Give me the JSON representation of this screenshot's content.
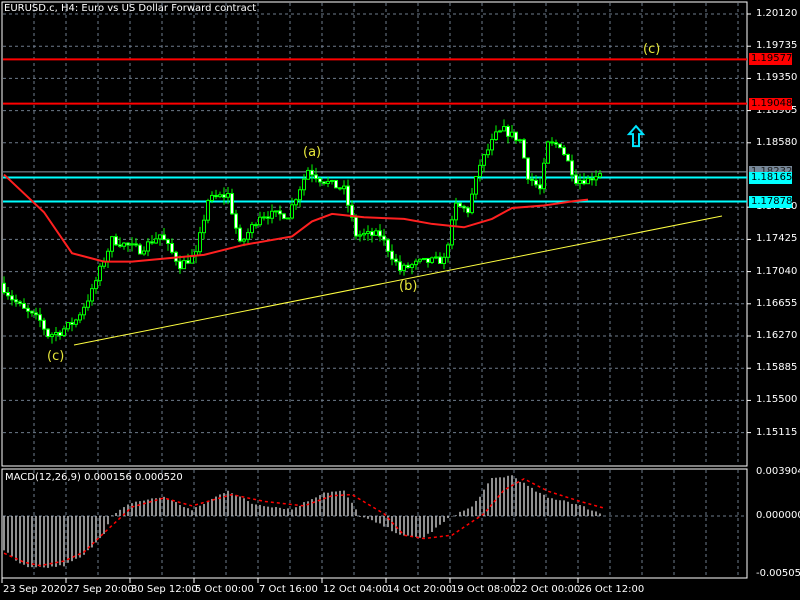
{
  "header": {
    "title": "EURUSD.c, H4:  Euro vs US Dollar Forward contract"
  },
  "colors": {
    "bull": "#00ff00",
    "bear_body": "#ffffff",
    "ma": "#ff2020",
    "trend": "#ffff40",
    "hline_red": "#ff0000",
    "hline_cyan": "#00ffff",
    "grid": "#6e7b8b",
    "macd_hist": "#c0c0c0",
    "macd_signal": "#ff0000"
  },
  "price_axis": {
    "ticks": [
      "1.20120",
      "1.19735",
      "1.19350",
      "1.18965",
      "1.18580",
      "1.17810",
      "1.17425",
      "1.17040",
      "1.16655",
      "1.16270",
      "1.15885",
      "1.15500",
      "1.15115"
    ],
    "max": 1.2012,
    "step": 0.00385
  },
  "price_tags": [
    {
      "value": "1.19577",
      "kind": "red"
    },
    {
      "value": "1.19048",
      "kind": "red"
    },
    {
      "value": "1.18232",
      "kind": "grey"
    },
    {
      "value": "1.18165",
      "kind": "cyan"
    },
    {
      "value": "1.17878",
      "kind": "cyan"
    }
  ],
  "price_anchors": [
    [
      0,
      1.169
    ],
    [
      3,
      1.1672
    ],
    [
      6,
      1.1658
    ],
    [
      10,
      1.1645
    ],
    [
      12,
      1.1628
    ],
    [
      15,
      1.1632
    ],
    [
      19,
      1.1646
    ],
    [
      23,
      1.168
    ],
    [
      25,
      1.1706
    ],
    [
      28,
      1.1742
    ],
    [
      32,
      1.1735
    ],
    [
      35,
      1.173
    ],
    [
      40,
      1.1748
    ],
    [
      45,
      1.1712
    ],
    [
      49,
      1.1724
    ],
    [
      52,
      1.179
    ],
    [
      57,
      1.1796
    ],
    [
      60,
      1.1736
    ],
    [
      65,
      1.1772
    ],
    [
      72,
      1.1772
    ],
    [
      77,
      1.1826
    ],
    [
      80,
      1.1815
    ],
    [
      83,
      1.1808
    ],
    [
      86,
      1.1802
    ],
    [
      89,
      1.1748
    ],
    [
      95,
      1.1748
    ],
    [
      100,
      1.1706
    ],
    [
      105,
      1.1715
    ],
    [
      111,
      1.1718
    ],
    [
      114,
      1.1783
    ],
    [
      117,
      1.1777
    ],
    [
      120,
      1.1832
    ],
    [
      124,
      1.1867
    ],
    [
      126,
      1.1873
    ],
    [
      130,
      1.1861
    ],
    [
      132,
      1.1819
    ],
    [
      135,
      1.1802
    ],
    [
      137,
      1.1856
    ],
    [
      140,
      1.1856
    ],
    [
      144,
      1.1814
    ],
    [
      147,
      1.1814
    ],
    [
      150,
      1.1823
    ]
  ],
  "ma_anchors": [
    [
      0,
      1.182
    ],
    [
      10,
      1.1775
    ],
    [
      17,
      1.1726
    ],
    [
      25,
      1.1716
    ],
    [
      32,
      1.1716
    ],
    [
      50,
      1.1724
    ],
    [
      60,
      1.1736
    ],
    [
      72,
      1.1746
    ],
    [
      77,
      1.1764
    ],
    [
      82,
      1.1773
    ],
    [
      90,
      1.1769
    ],
    [
      100,
      1.1767
    ],
    [
      107,
      1.1761
    ],
    [
      115,
      1.1757
    ],
    [
      122,
      1.1767
    ],
    [
      127,
      1.178
    ],
    [
      135,
      1.1783
    ],
    [
      142,
      1.1788
    ],
    [
      146,
      1.179
    ]
  ],
  "trendline": {
    "from": [
      17.5,
      1.16162
    ],
    "to": [
      179.5,
      1.17705
    ]
  },
  "wave_labels": [
    {
      "text": "(c)",
      "bar": 13,
      "price": 1.1601
    },
    {
      "text": "(a)",
      "bar": 77,
      "price": 1.1845
    },
    {
      "text": "(b)",
      "bar": 101,
      "price": 1.1684
    },
    {
      "text": "(c)",
      "bar": 162,
      "price": 1.1968
    }
  ],
  "arrow": {
    "icon": "up-arrow-icon",
    "bar": 158,
    "price": 1.1866
  },
  "macd": {
    "title": "MACD(12,26,9) 0.000156 0.000520",
    "ticks": [
      "0.003904",
      "0.000000",
      "-0.005058"
    ],
    "max": 0.003904,
    "min": -0.005058,
    "hist_anchors": [
      [
        0,
        -0.003
      ],
      [
        3,
        -0.004
      ],
      [
        6,
        -0.0046
      ],
      [
        10,
        -0.0046
      ],
      [
        15,
        -0.0044
      ],
      [
        20,
        -0.0035
      ],
      [
        25,
        -0.0015
      ],
      [
        27,
        0
      ],
      [
        32,
        0.0012
      ],
      [
        40,
        0.0017
      ],
      [
        47,
        0.0005
      ],
      [
        56,
        0.0023
      ],
      [
        62,
        0.0011
      ],
      [
        72,
        0.0006
      ],
      [
        80,
        0.0021
      ],
      [
        85,
        0.0022
      ],
      [
        89,
        0
      ],
      [
        95,
        -0.0009
      ],
      [
        100,
        -0.0018
      ],
      [
        105,
        -0.0019
      ],
      [
        112,
        0
      ],
      [
        117,
        0.0008
      ],
      [
        122,
        0.0033
      ],
      [
        127,
        0.0036
      ],
      [
        132,
        0.0024
      ],
      [
        136,
        0.0016
      ],
      [
        140,
        0.0014
      ],
      [
        145,
        0.0008
      ],
      [
        150,
        0.0001
      ]
    ],
    "signal_anchors": [
      [
        0,
        -0.0033
      ],
      [
        5,
        -0.0041
      ],
      [
        9,
        -0.0044
      ],
      [
        15,
        -0.004
      ],
      [
        20,
        -0.0032
      ],
      [
        25,
        -0.0015
      ],
      [
        32,
        0.0008
      ],
      [
        40,
        0.0016
      ],
      [
        47,
        0.0009
      ],
      [
        57,
        0.0019
      ],
      [
        65,
        0.0013
      ],
      [
        75,
        0.0009
      ],
      [
        82,
        0.0018
      ],
      [
        87,
        0.0019
      ],
      [
        95,
        0.0002
      ],
      [
        100,
        -0.0017
      ],
      [
        105,
        -0.002
      ],
      [
        112,
        -0.0017
      ],
      [
        120,
        0.0002
      ],
      [
        125,
        0.0023
      ],
      [
        130,
        0.0033
      ],
      [
        136,
        0.0022
      ],
      [
        144,
        0.0013
      ],
      [
        150,
        0.0007
      ]
    ]
  },
  "time_axis": [
    "23 Sep 2020",
    "27 Sep 20:00",
    "30 Sep 12:00",
    "5 Oct 00:00",
    "7 Oct 16:00",
    "12 Oct 04:00",
    "14 Oct 20:00",
    "19 Oct 08:00",
    "22 Oct 00:00",
    "26 Oct 12:00"
  ]
}
